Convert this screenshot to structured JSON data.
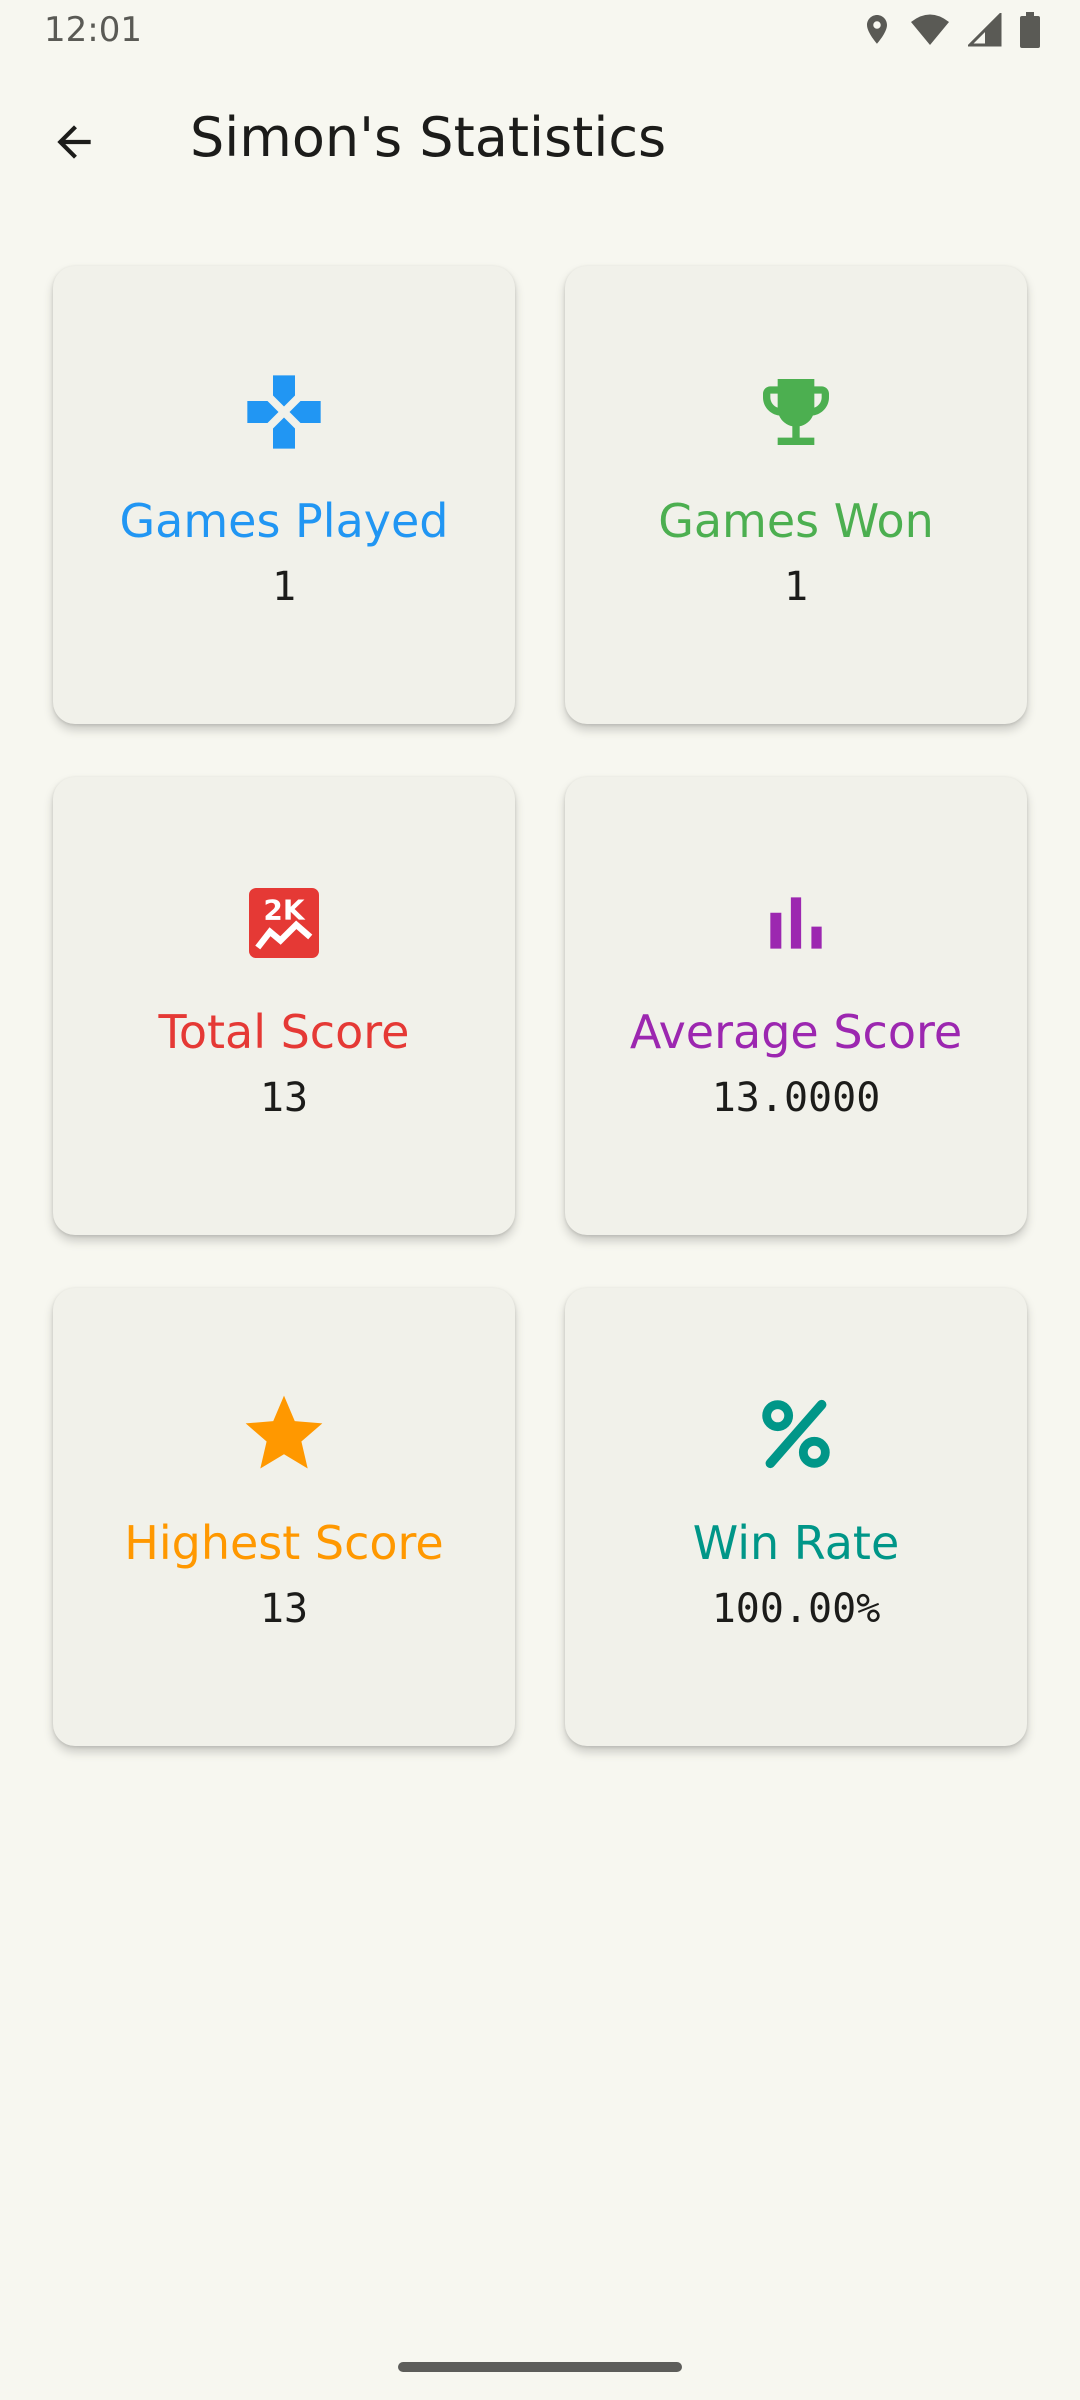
{
  "status_bar": {
    "time": "12:01",
    "icons": [
      "location-icon",
      "wifi-icon",
      "signal-icon",
      "battery-icon"
    ]
  },
  "app_bar": {
    "back_icon": "arrow-back-icon",
    "title": "Simon's Statistics"
  },
  "colors": {
    "background": "#f7f7f0",
    "card": "#f1f1ea",
    "games_played": "#2196f3",
    "games_won": "#4caf50",
    "total_score": "#e53935",
    "average_score": "#9c27b0",
    "highest_score": "#ff9800",
    "win_rate": "#009688"
  },
  "stats": [
    {
      "icon": "gamepad-icon",
      "label": "Games Played",
      "value": "1"
    },
    {
      "icon": "trophy-icon",
      "label": "Games Won",
      "value": "1"
    },
    {
      "icon": "score-2k-icon",
      "label": "Total Score",
      "value": "13"
    },
    {
      "icon": "bar-chart-icon",
      "label": "Average Score",
      "value": "13.0000"
    },
    {
      "icon": "star-icon",
      "label": "Highest Score",
      "value": "13"
    },
    {
      "icon": "percent-icon",
      "label": "Win Rate",
      "value": "100.00%"
    }
  ]
}
